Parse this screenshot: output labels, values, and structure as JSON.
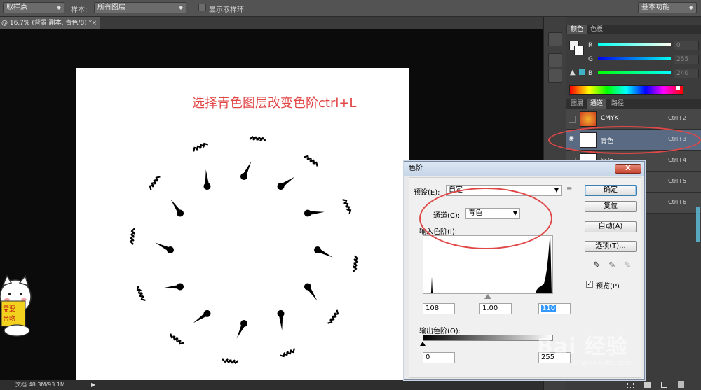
{
  "options_bar": {
    "tool_preset": "取样点",
    "sample_label": "样本:",
    "sample_value": "所有图层",
    "show_ring_label": "显示取样环",
    "workspace": "基本功能"
  },
  "doc_tab": {
    "title": "@ 16.7% (背景 副本, 青色/8) *",
    "close": "×"
  },
  "canvas": {
    "overlay_text": "选择青色图层改变色阶ctrl+L"
  },
  "status_bar": {
    "doc_info": "文档:48.3M/93.1M",
    "play": "▶"
  },
  "sticker": {
    "text": "需要亲吻"
  },
  "color_panel": {
    "tabs": [
      "颜色",
      "色板"
    ],
    "rows": [
      {
        "label": "R",
        "value": "0"
      },
      {
        "label": "G",
        "value": "255"
      },
      {
        "label": "B",
        "value": "240"
      }
    ]
  },
  "channels_panel": {
    "tabs": [
      "图层",
      "通道",
      "路径"
    ],
    "channels": [
      {
        "name": "CMYK",
        "shortcut": "Ctrl+2",
        "visible": false,
        "selected": false
      },
      {
        "name": "青色",
        "shortcut": "Ctrl+3",
        "visible": true,
        "selected": true
      },
      {
        "name": "洋红",
        "shortcut": "Ctrl+4",
        "visible": false,
        "selected": false
      },
      {
        "name": "",
        "shortcut": "Ctrl+5",
        "visible": false,
        "selected": false
      },
      {
        "name": "",
        "shortcut": "Ctrl+6",
        "visible": false,
        "selected": false
      }
    ]
  },
  "levels_dialog": {
    "title": "色阶",
    "close": "X",
    "preset_label": "预设(E):",
    "preset_value": "自定",
    "channel_label": "通道(C):",
    "channel_value": "青色",
    "input_levels_label": "输入色阶(I):",
    "input_black": "108",
    "input_gamma": "1.00",
    "input_white": "110",
    "output_levels_label": "输出色阶(O):",
    "output_black": "0",
    "output_white": "255",
    "buttons": {
      "ok": "确定",
      "reset": "复位",
      "auto": "自动(A)",
      "options": "选项(T)..."
    },
    "preview_label": "预览(P)",
    "preview_checked": true
  },
  "watermark": {
    "brand": "Bai 经验",
    "url": "jingyan.baidu.com"
  },
  "accent_colors": {
    "annotation_red": "#e04848",
    "overlay_text_red": "#e24747",
    "selected_row": "#5a6a82"
  }
}
